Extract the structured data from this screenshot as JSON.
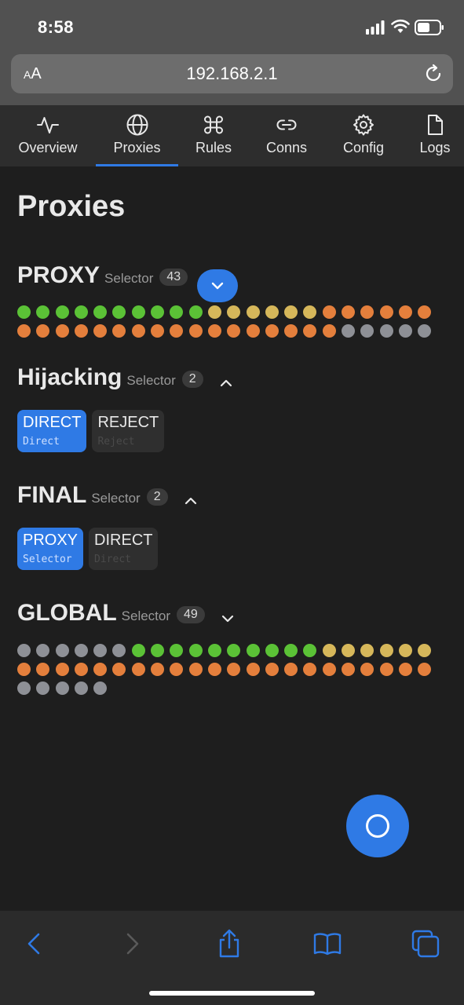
{
  "status": {
    "time": "8:58"
  },
  "browser": {
    "aa_label_small": "A",
    "aa_label_big": "A",
    "url": "192.168.2.1"
  },
  "tabs": [
    {
      "label": "Overview",
      "icon": "activity-icon"
    },
    {
      "label": "Proxies",
      "icon": "globe-icon",
      "active": true
    },
    {
      "label": "Rules",
      "icon": "command-icon"
    },
    {
      "label": "Conns",
      "icon": "link-icon"
    },
    {
      "label": "Config",
      "icon": "gear-icon"
    },
    {
      "label": "Logs",
      "icon": "file-icon"
    }
  ],
  "page": {
    "title": "Proxies"
  },
  "colors": {
    "accent": "#2f7ae5",
    "green": "#5bc236",
    "yellow": "#d6b75a",
    "orange": "#e47f3c",
    "gray": "#8e9096"
  },
  "groups": [
    {
      "name": "PROXY",
      "type": "Selector",
      "count": "43",
      "toggle": "chevron-down-icon",
      "dots": [
        "g",
        "g",
        "g",
        "g",
        "g",
        "g",
        "g",
        "g",
        "g",
        "g",
        "y",
        "y",
        "y",
        "y",
        "y",
        "y",
        "o",
        "o",
        "o",
        "o",
        "o",
        "o",
        "o",
        "o",
        "o",
        "o",
        "o",
        "o",
        "o",
        "o",
        "o",
        "o",
        "o",
        "o",
        "o",
        "o",
        "o",
        "o",
        "o",
        "x",
        "x",
        "x",
        "x",
        "x"
      ]
    },
    {
      "name": "Hijacking",
      "type": "Selector",
      "count": "2",
      "toggle": "chevron-up-icon",
      "options": [
        {
          "name": "DIRECT",
          "type": "Direct",
          "selected": true
        },
        {
          "name": "REJECT",
          "type": "Reject",
          "selected": false
        }
      ]
    },
    {
      "name": "FINAL",
      "type": "Selector",
      "count": "2",
      "toggle": "chevron-up-icon",
      "options": [
        {
          "name": "PROXY",
          "type": "Selector",
          "selected": true
        },
        {
          "name": "DIRECT",
          "type": "Direct",
          "selected": false
        }
      ]
    },
    {
      "name": "GLOBAL",
      "type": "Selector",
      "count": "49",
      "toggle": "chevron-down-icon",
      "dots": [
        "x",
        "x",
        "x",
        "x",
        "x",
        "x",
        "g",
        "g",
        "g",
        "g",
        "g",
        "g",
        "g",
        "g",
        "g",
        "g",
        "y",
        "y",
        "y",
        "y",
        "y",
        "y",
        "o",
        "o",
        "o",
        "o",
        "o",
        "o",
        "o",
        "o",
        "o",
        "o",
        "o",
        "o",
        "o",
        "o",
        "o",
        "o",
        "o",
        "o",
        "o",
        "o",
        "o",
        "o",
        "x",
        "x",
        "x",
        "x",
        "x"
      ]
    }
  ],
  "fab": {
    "icon": "circle-icon"
  },
  "toolbar": [
    "back-icon",
    "forward-icon",
    "share-icon",
    "bookmarks-icon",
    "tabs-icon"
  ]
}
